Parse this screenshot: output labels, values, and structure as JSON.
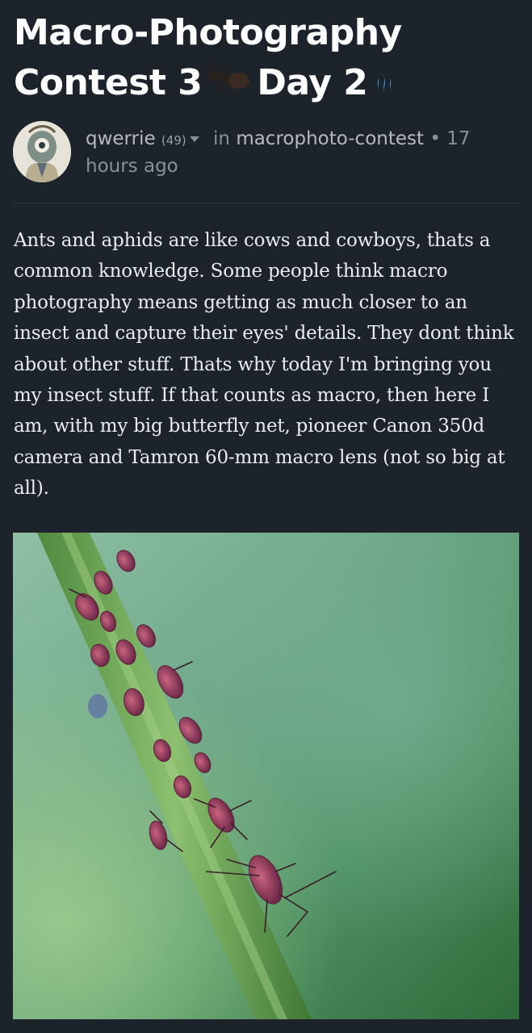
{
  "post": {
    "title_part1": "Macro-Photography Contest 3",
    "title_part2": "Day 2",
    "title_emoji": "ant-icon",
    "title_badge": "steem-icon"
  },
  "author": {
    "name": "qwerrie",
    "reputation": "(49)",
    "in_label": "in",
    "community": "macrophoto-contest",
    "separator": "•",
    "time": "17 hours ago"
  },
  "body": {
    "paragraph": "Ants and aphids are like cows and cowboys, thats a common knowledge. Some people think macro photography means getting as much closer to an insect and capture their eyes' details. They dont think about other stuff. Thats why today I'm bringing you my insect stuff. If that counts as macro, then here I am, with my big butterfly net, pioneer Canon 350d camera and Tamron 60-mm macro lens (not so big at all)."
  },
  "photo": {
    "subject": "aphids on a green plant stem"
  },
  "colors": {
    "background": "#1d232b",
    "title": "#ffffff",
    "meta": "#8a9099",
    "body": "#e9ebee",
    "steem_blue": "#4ba2f2"
  }
}
